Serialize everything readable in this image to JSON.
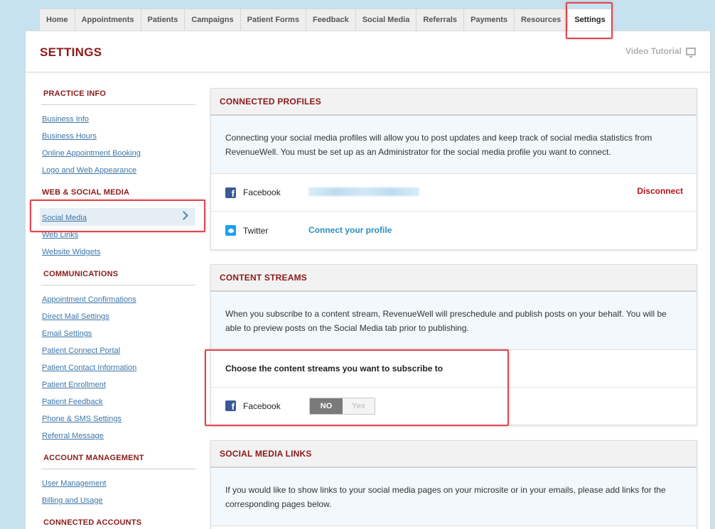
{
  "nav": {
    "tabs": [
      {
        "label": "Home"
      },
      {
        "label": "Appointments"
      },
      {
        "label": "Patients"
      },
      {
        "label": "Campaigns"
      },
      {
        "label": "Patient Forms"
      },
      {
        "label": "Feedback"
      },
      {
        "label": "Social Media"
      },
      {
        "label": "Referrals"
      },
      {
        "label": "Payments"
      },
      {
        "label": "Resources"
      },
      {
        "label": "Settings"
      }
    ],
    "active": "Settings"
  },
  "header": {
    "title": "SETTINGS",
    "video_tutorial": "Video Tutorial",
    "video_icon": "monitor-icon"
  },
  "sidebar": {
    "practice_info": {
      "heading": "PRACTICE INFO",
      "links": [
        "Business Info",
        "Business Hours",
        "Online Appointment Booking",
        "Logo and Web Appearance"
      ]
    },
    "web_social": {
      "heading": "WEB & SOCIAL MEDIA",
      "links": [
        "Social Media",
        "Web Links",
        "Website Widgets"
      ],
      "selected": "Social Media"
    },
    "communications": {
      "heading": "COMMUNICATIONS",
      "links": [
        "Appointment Confirmations",
        "Direct Mail Settings",
        "Email Settings",
        "Patient Connect Portal",
        "Patient Contact Information",
        "Patient Enrollment",
        "Patient Feedback",
        "Phone & SMS Settings",
        "Referral Message"
      ]
    },
    "account_management": {
      "heading": "ACCOUNT MANAGEMENT",
      "links": [
        "User Management",
        "Billing and Usage"
      ]
    },
    "connected_accounts": {
      "heading": "CONNECTED ACCOUNTS"
    }
  },
  "connected_profiles": {
    "title": "CONNECTED PROFILES",
    "description": "Connecting your social media profiles will allow you to post updates and keep track of social media statistics from RevenueWell. You must be set up as an Administrator for the social media profile you want to connect.",
    "facebook": {
      "name": "Facebook",
      "action": "Disconnect"
    },
    "twitter": {
      "name": "Twitter",
      "action": "Connect your profile"
    }
  },
  "content_streams": {
    "title": "CONTENT STREAMS",
    "description": "When you subscribe to a content stream, RevenueWell will preschedule and publish posts on your behalf. You will be able to preview posts on the Social Media tab prior to publishing.",
    "choose_label": "Choose the content streams you want to subscribe to",
    "facebook": {
      "name": "Facebook",
      "no_label": "NO",
      "yes_label": "Yes",
      "value": "NO"
    }
  },
  "social_media_links": {
    "title": "SOCIAL MEDIA LINKS",
    "description": "If you would like to show links to your social media pages on your microsite or in your emails, please add links for the corresponding pages below."
  },
  "colors": {
    "accent": "#8b1a1a",
    "link": "#3d76a8",
    "highlight": "#e0454f",
    "facebook": "#3b5998",
    "twitter": "#1da1f2"
  }
}
